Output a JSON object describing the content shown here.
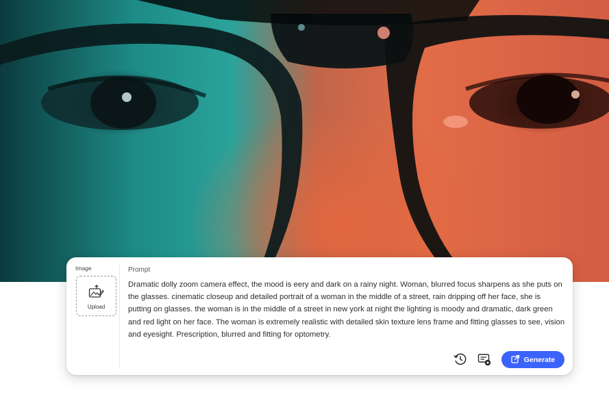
{
  "image_panel": {
    "label": "Image",
    "upload_label": "Upload",
    "upload_icon": "image-upload-icon"
  },
  "prompt_panel": {
    "label": "Prompt",
    "text": "Dramatic dolly zoom camera effect, the mood is eery and dark on a rainy night. Woman, blurred focus sharpens as she puts on the glasses. cinematic closeup and detailed portrait of a woman in the middle of a street, rain dripping off her face, she is putting on glasses. the woman is in the middle of a street in new york at night the lighting is moody and dramatic, dark green and red light on her face. The woman is extremely realistic with detailed skin texture lens frame and fitting glasses to see, vision and eyesight. Prescription, blurred and fitting for optometry."
  },
  "actions": {
    "history_icon": "history-icon",
    "settings_icon": "prompt-settings-icon",
    "generate_icon": "generate-icon",
    "generate_label": "Generate"
  },
  "colors": {
    "accent": "#3b63fb",
    "hero_left": "#1d8b86",
    "hero_right": "#e26c48"
  }
}
